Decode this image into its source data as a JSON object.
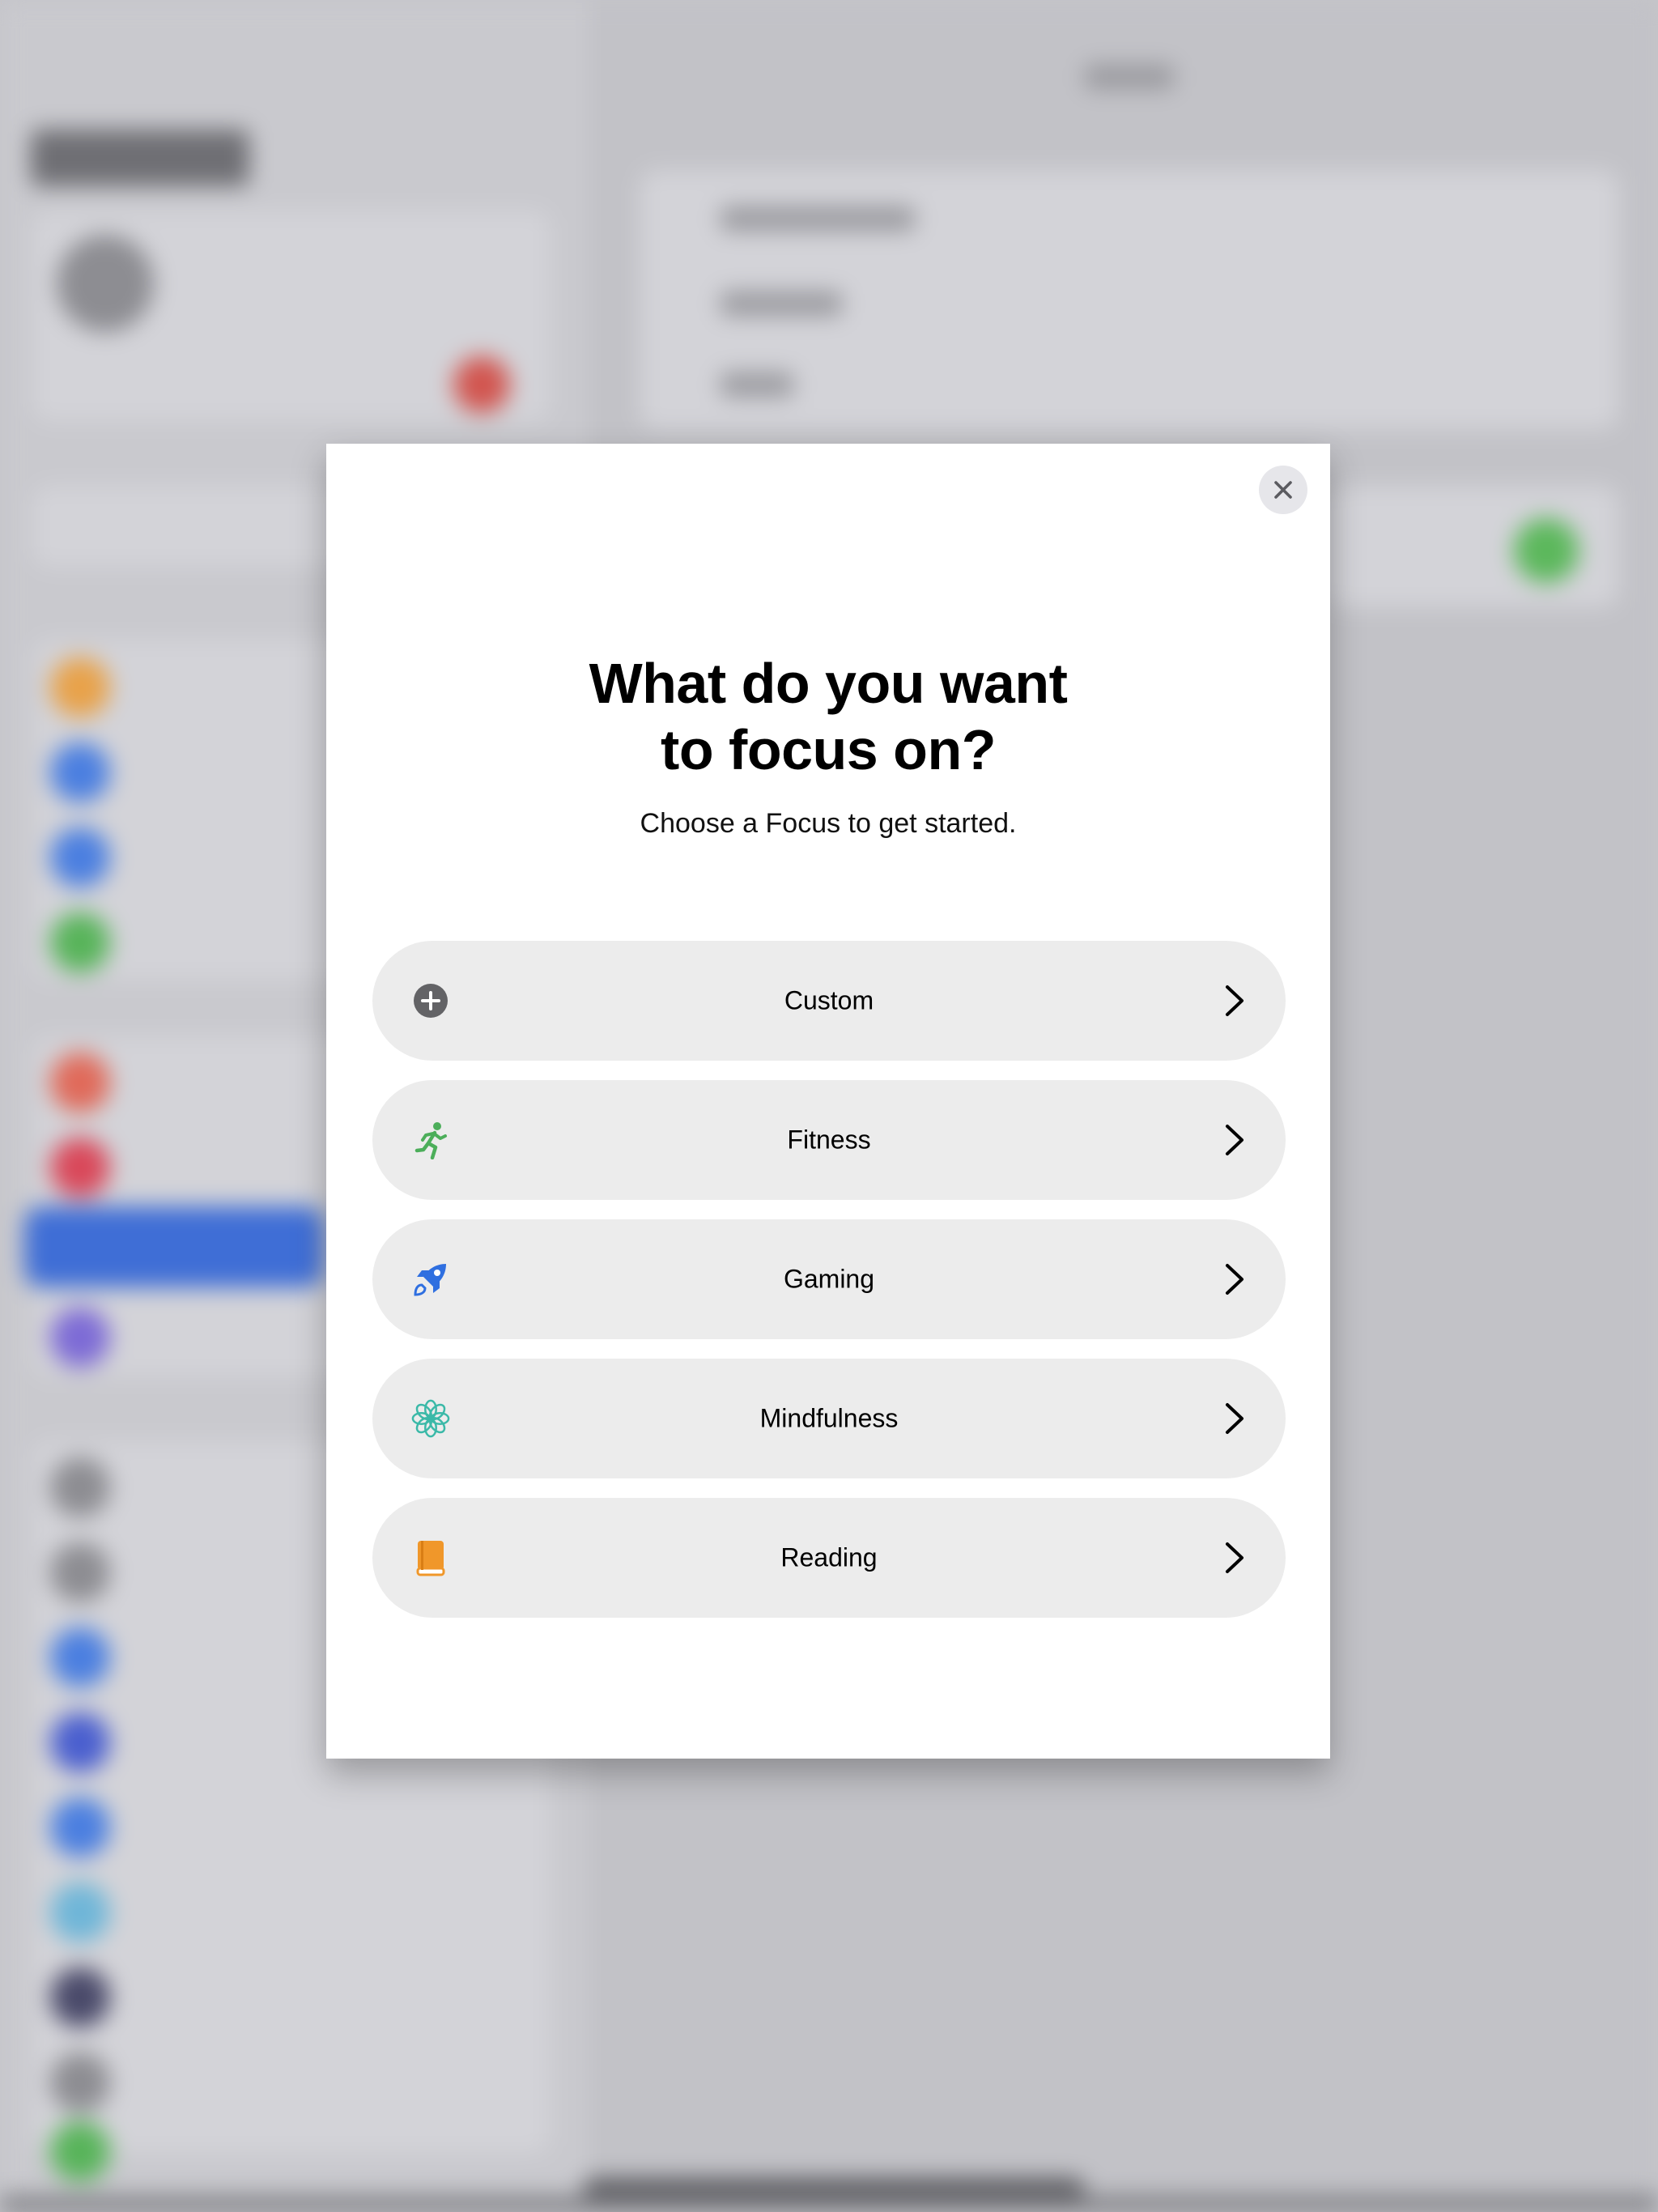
{
  "modal": {
    "title_line1": "What do you want",
    "title_line2": "to focus on?",
    "subtitle": "Choose a Focus to get started.",
    "close_icon": "xmark-icon",
    "options": [
      {
        "label": "Custom",
        "icon": "plus-circle-icon",
        "icon_color": "#636366"
      },
      {
        "label": "Fitness",
        "icon": "running-figure-icon",
        "icon_color": "#4cae5a"
      },
      {
        "label": "Gaming",
        "icon": "rocket-icon",
        "icon_color": "#2f6fe0"
      },
      {
        "label": "Mindfulness",
        "icon": "flower-icon",
        "icon_color": "#3bb9a8"
      },
      {
        "label": "Reading",
        "icon": "book-icon",
        "icon_color": "#f0972a"
      }
    ]
  }
}
